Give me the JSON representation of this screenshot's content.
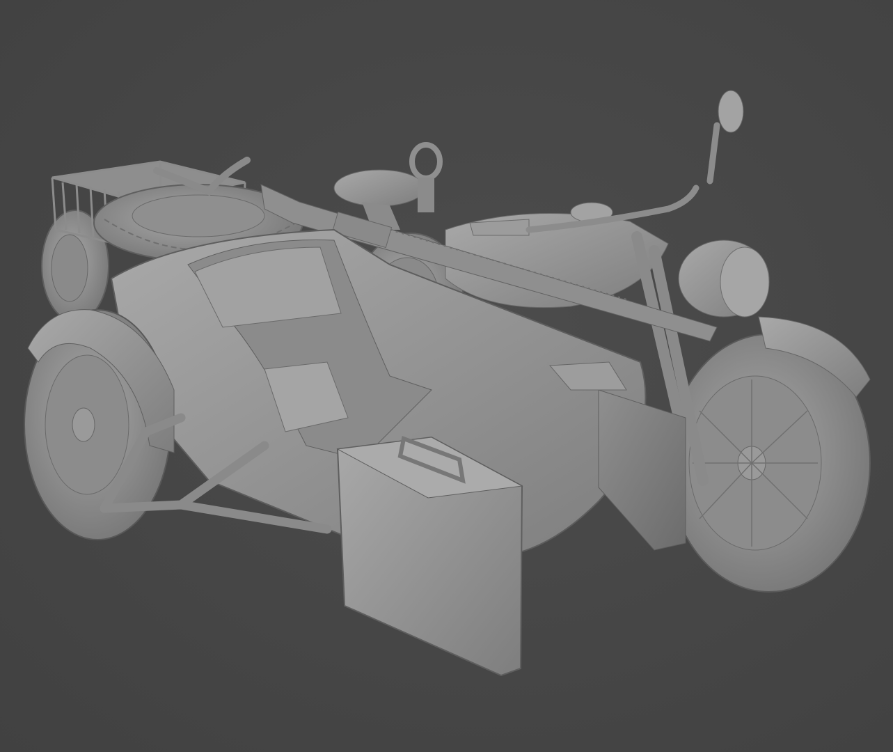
{
  "scene": {
    "background_color": "#464646",
    "model_color": "#9a9a9a",
    "subject": "motorcycle-with-sidecar-clay-render"
  }
}
